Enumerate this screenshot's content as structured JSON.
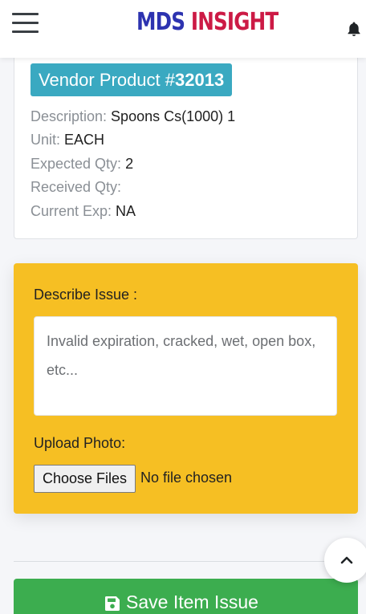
{
  "header": {
    "logo_part1": "MDS",
    "logo_part2": " INSIGHT",
    "menu_icon": "hamburger-menu-icon",
    "bell_icon": "bell-icon"
  },
  "product": {
    "badge_prefix": "Vendor Product #",
    "badge_number": "32013",
    "description_label": "Description:",
    "description_value": " Spoons Cs(1000) 1",
    "unit_label": "Unit:",
    "unit_value": " EACH",
    "expected_label": "Expected Qty:",
    "expected_value": " 2",
    "received_label": "Received Qty:",
    "received_value": "",
    "exp_label": "Current Exp:",
    "exp_value": " NA"
  },
  "issue_form": {
    "describe_label": "Describe Issue :",
    "describe_placeholder": "Invalid expiration, cracked, wet, open box, etc...",
    "describe_value": "",
    "upload_label": "Upload Photo:",
    "choose_files_label": "Choose Files",
    "no_file_text": "No file chosen"
  },
  "actions": {
    "save_label": "Save Item Issue",
    "save_icon": "floppy-disk-icon",
    "scroll_top_icon": "chevron-up-icon"
  },
  "colors": {
    "panel_bg": "#f6bf23",
    "badge_bg": "#3aa9c1",
    "save_bg": "#3cad4f",
    "logo_blue": "#2d33b0",
    "logo_red": "#cc1a45"
  }
}
